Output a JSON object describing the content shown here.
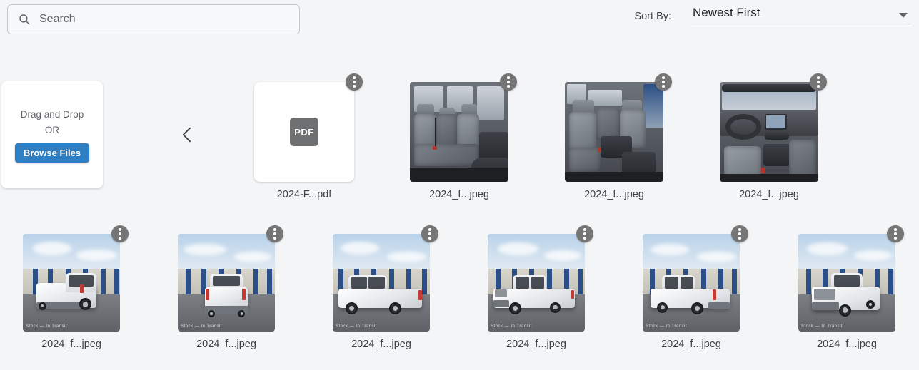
{
  "search": {
    "placeholder": "Search",
    "value": "",
    "icon": "search-icon"
  },
  "sort": {
    "label": "Sort By:",
    "selected": "Newest First",
    "options": [
      "Newest First"
    ],
    "caret_icon": "chevron-down-icon"
  },
  "dropzone": {
    "line1": "Drag and Drop",
    "line2": "OR",
    "browse_label": "Browse Files"
  },
  "pagination": {
    "prev_icon": "chevron-left-icon"
  },
  "card_menu": {
    "icon": "more-vertical-icon"
  },
  "files": [
    {
      "caption": "2024-F...pdf",
      "kind": "pdf",
      "badge": "PDF",
      "scene": "pdf"
    },
    {
      "caption": "2024_f...jpeg",
      "kind": "image",
      "scene": "interior-rear-seats"
    },
    {
      "caption": "2024_f...jpeg",
      "kind": "image",
      "scene": "interior-front-seats"
    },
    {
      "caption": "2024_f...jpeg",
      "kind": "image",
      "scene": "interior-dashboard"
    },
    {
      "caption": "2024_f...jpeg",
      "kind": "image",
      "scene": "exterior-rear-right"
    },
    {
      "caption": "2024_f...jpeg",
      "kind": "image",
      "scene": "exterior-rear"
    },
    {
      "caption": "2024_f...jpeg",
      "kind": "image",
      "scene": "exterior-side"
    },
    {
      "caption": "2024_f...jpeg",
      "kind": "image",
      "scene": "exterior-front-left"
    },
    {
      "caption": "2024_f...jpeg",
      "kind": "image",
      "scene": "exterior-rear-left"
    },
    {
      "caption": "2024_f...jpeg",
      "kind": "image",
      "scene": "exterior-front-right"
    }
  ],
  "watermark": "Stock — In Transit",
  "colors": {
    "page_background": "#f4f5f7",
    "accent_blue": "#2e7fc4",
    "menu_circle": "#757575",
    "pdf_badge": "#6f7072",
    "text_primary": "#3c4043"
  }
}
